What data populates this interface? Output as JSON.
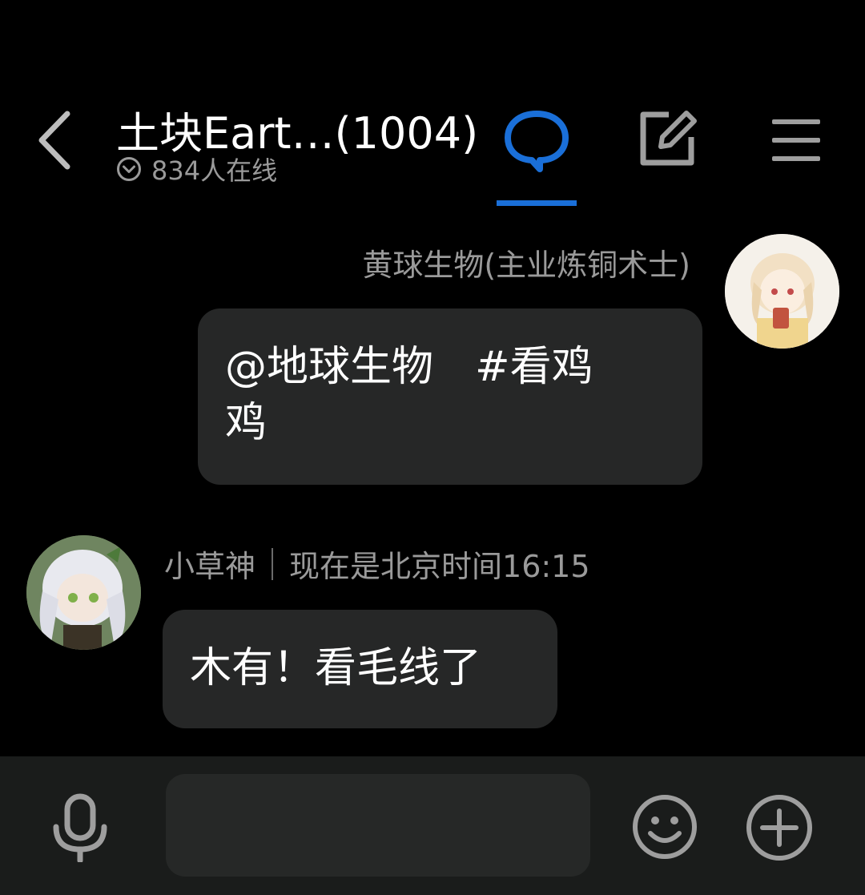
{
  "header": {
    "title": "土块Eart…(1004)",
    "online_text": "834人在线",
    "icons": {
      "back": "back-chevron-icon",
      "chat_tab": "chat-bubble-icon",
      "note_tab": "edit-note-icon",
      "menu": "hamburger-menu-icon",
      "online": "chevron-down-circle-icon"
    }
  },
  "messages": [
    {
      "side": "right",
      "sender": "黄球生物(主业炼铜术士)",
      "line1": "@地球生物　#看鸡",
      "line2": "鸡"
    },
    {
      "side": "left",
      "sender": "小草神",
      "sender_status": "现在是北京时间16:15",
      "text": "木有！看毛线了"
    }
  ],
  "input_bar": {
    "placeholder": "",
    "icons": {
      "mic": "microphone-icon",
      "emoji": "emoji-icon",
      "plus": "plus-circle-icon"
    }
  },
  "colors": {
    "background": "#000000",
    "bubble": "#262727",
    "accent": "#1a6fd8",
    "muted_text": "#9a9a9a",
    "input_bar": "#1a1c1b"
  }
}
